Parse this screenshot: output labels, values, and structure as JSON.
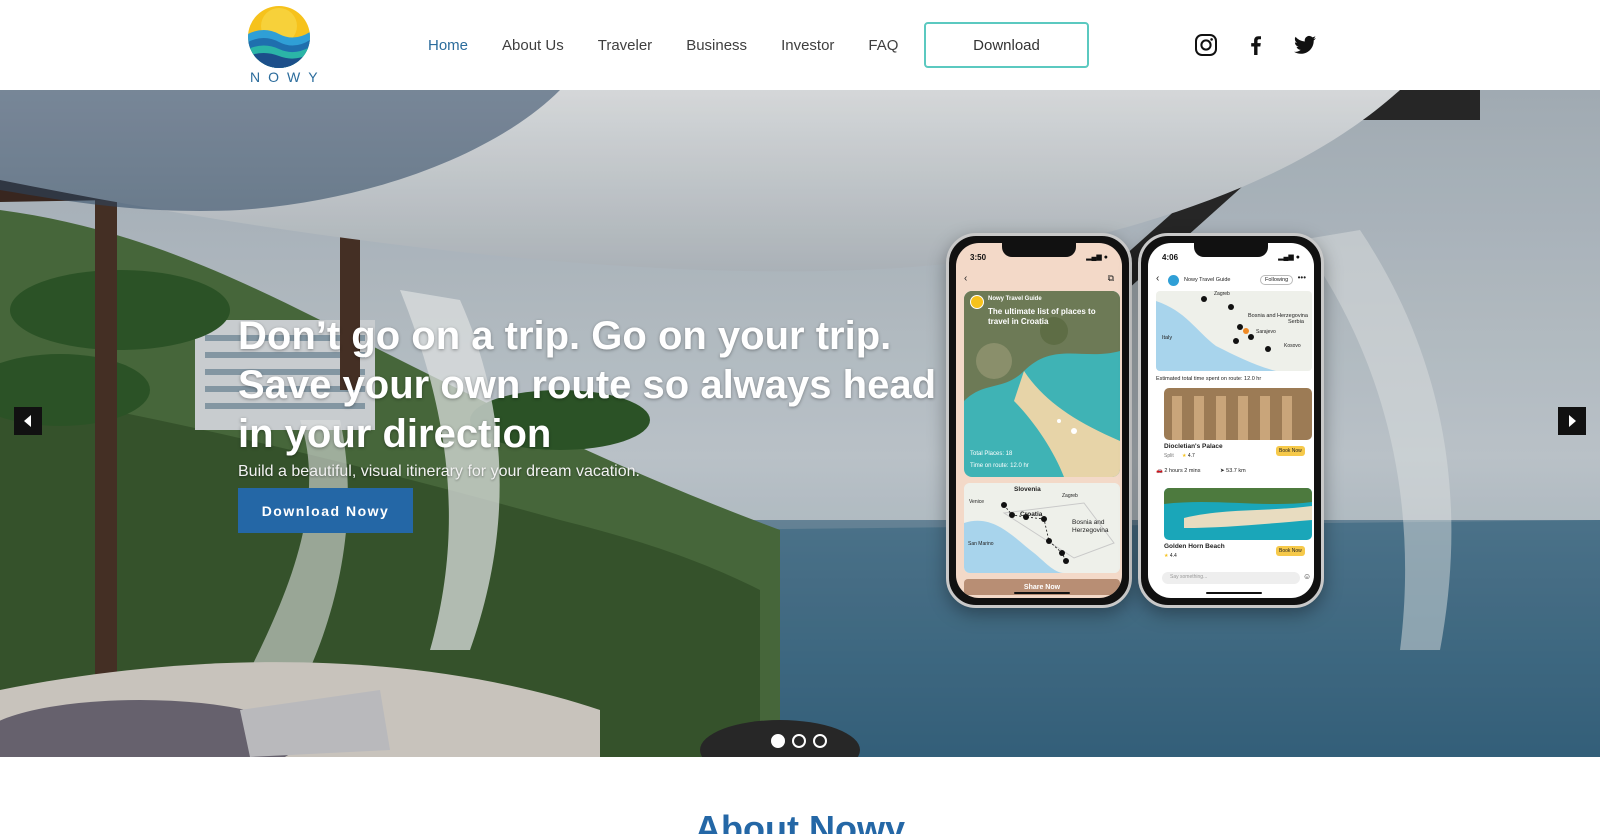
{
  "brand": {
    "name": "NOWY"
  },
  "nav": {
    "items": [
      {
        "label": "Home",
        "active": true
      },
      {
        "label": "About Us"
      },
      {
        "label": "Traveler"
      },
      {
        "label": "Business"
      },
      {
        "label": "Investor"
      },
      {
        "label": "FAQ"
      }
    ],
    "download_label": "Download"
  },
  "social": {
    "instagram": "instagram-icon",
    "facebook": "facebook-icon",
    "twitter": "twitter-icon"
  },
  "hero": {
    "headline_line1": "Don’t go on a trip. Go on your trip.",
    "headline_line2": "Save your own route so always head",
    "headline_line3": "in your direction",
    "subline": "Build a beautiful, visual itinerary for your dream vacation.",
    "cta_label": "Download Nowy",
    "slides_total": 3,
    "slide_active": 1,
    "accent_color": "#2467a6"
  },
  "phone_left": {
    "time": "3:50",
    "guide_name": "Nowy Travel Guide",
    "card_title": "The ultimate list of places to travel in Croatia",
    "total_places": "Total Places: 18",
    "time_on_route": "Time on route: 12.0 hr",
    "map_labels": [
      "Slovenia",
      "Zagreb",
      "Venice",
      "Croatia",
      "San Marino",
      "Bosnia and Herzegovina"
    ],
    "share_label": "Share Now"
  },
  "phone_right": {
    "time": "4:06",
    "guide_name": "Nowy Travel Guide",
    "following_label": "Following",
    "map_labels": [
      "Zagreb",
      "Bosnia and Herzegovina",
      "Sarajevo",
      "Serbia",
      "Italy",
      "Kosovo"
    ],
    "estimate": "Estimated total time spent on route: 12.0 hr",
    "place1_name": "Diocletian's Palace",
    "place1_city": "Split",
    "place1_rating": "4.7",
    "book_label": "Book Now",
    "travel_time": "2 hours 2 mins",
    "travel_distance": "53.7 km",
    "place2_name": "Golden Horn Beach",
    "place2_rating": "4.4",
    "comment_placeholder": "Say something..."
  },
  "about": {
    "title": "About Nowy"
  }
}
